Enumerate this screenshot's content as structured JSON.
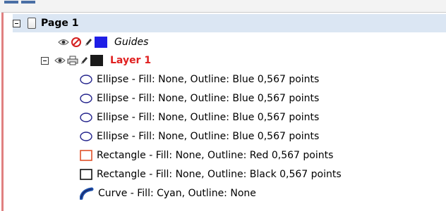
{
  "tree": {
    "page": {
      "label": "Page 1"
    },
    "guides": {
      "label": "Guides",
      "color": "#1e1ee6"
    },
    "layer": {
      "label": "Layer 1",
      "label_color": "#e02020",
      "swatch_color": "#1a1a1a"
    },
    "objects": [
      {
        "icon": "ellipse-icon",
        "label": "Ellipse - Fill: None, Outline: Blue  0,567 points"
      },
      {
        "icon": "ellipse-icon",
        "label": "Ellipse - Fill: None, Outline: Blue  0,567 points"
      },
      {
        "icon": "ellipse-icon",
        "label": "Ellipse - Fill: None, Outline: Blue  0,567 points"
      },
      {
        "icon": "ellipse-icon",
        "label": "Ellipse - Fill: None, Outline: Blue  0,567 points"
      },
      {
        "icon": "rectangle-red-icon",
        "label": "Rectangle - Fill: None, Outline: Red  0,567 points"
      },
      {
        "icon": "rectangle-black-icon",
        "label": "Rectangle - Fill: None, Outline: Black  0,567 points"
      },
      {
        "icon": "curve-icon",
        "label": "Curve - Fill: Cyan, Outline: None"
      }
    ]
  }
}
